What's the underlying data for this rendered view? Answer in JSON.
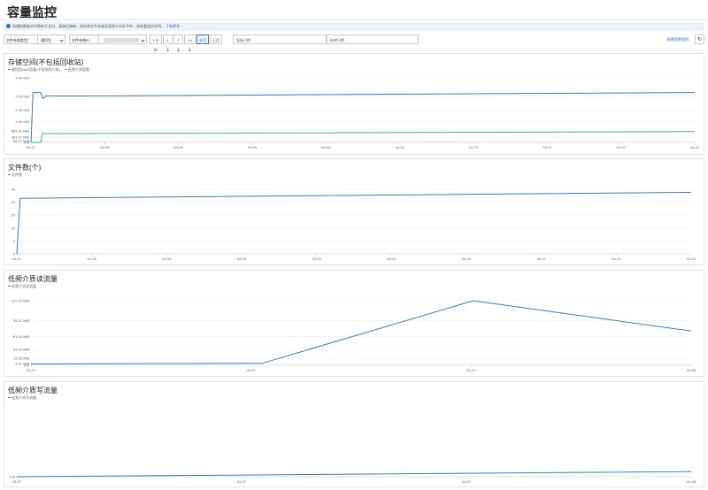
{
  "page": {
    "title": "容量监控"
  },
  "notice": {
    "text": "如遇新数据实时更新不及时，请稍后刷新，如存储文件系统总容量与实际不符，请查看监控说明。",
    "link": "了解更多"
  },
  "toolbar": {
    "fs_type_label": "文件系统类型：",
    "fs_type_value": "通用型",
    "fs_id_label": "文件系统ID：",
    "ranges": [
      "1 小时",
      "1 天",
      "7 天",
      "14 天",
      "本月",
      "上月"
    ],
    "active_range": "本月",
    "start_date": "起始日期",
    "end_date": "结束日期",
    "alarm_link": "配置报警规则",
    "refresh_icon": "refresh-icon"
  },
  "colors": {
    "blue": "#3b7fb6",
    "green": "#3fb68b"
  },
  "charts": [
    {
      "title": "存储空间(不包括回收站)",
      "legend": [
        "通用型NAS容量(不含低频介质)",
        "低频介质容量"
      ],
      "chart_data": {
        "type": "line",
        "yticks": [
          "4.66 GiB",
          "3.33 GiB",
          "2.33 GiB",
          "1.49 GiB",
          "858.31 MiB",
          "381.47 MiB",
          "95.37 MiB",
          "0 B"
        ],
        "xticks": [
          "04-07",
          "04-08",
          "04-08",
          "04-09",
          "04-09",
          "04-10",
          "04-10",
          "04-11",
          "04-12",
          "04-12"
        ],
        "series": [
          {
            "name": "通用型NAS容量(不含低频介质)",
            "color": "#3b7fb6",
            "points": [
              [
                0,
                0
              ],
              [
                0.3,
                3.6
              ],
              [
                1.5,
                3.6
              ],
              [
                1.7,
                3.2
              ],
              [
                2.0,
                3.2
              ],
              [
                2.2,
                3.35
              ],
              [
                8,
                3.35
              ],
              [
                100,
                3.6
              ]
            ]
          },
          {
            "name": "低频介质容量",
            "color": "#3fb68b",
            "points": [
              [
                0,
                0
              ],
              [
                1.5,
                0
              ],
              [
                1.7,
                0.65
              ],
              [
                2.0,
                0.65
              ],
              [
                2.2,
                0.63
              ],
              [
                100,
                0.78
              ]
            ]
          }
        ]
      }
    },
    {
      "title": "文件数(个)",
      "legend": [
        "文件数"
      ],
      "chart_data": {
        "type": "line",
        "yticks": [
          "25",
          "20",
          "15",
          "10",
          "5",
          "0"
        ],
        "xticks": [
          "04-07",
          "04-08",
          "04-08",
          "04-09",
          "04-09",
          "04-10",
          "04-10",
          "04-11",
          "04-12",
          "04-12"
        ],
        "series": [
          {
            "name": "文件数",
            "color": "#3b7fb6",
            "points": [
              [
                0,
                0
              ],
              [
                0.5,
                21.5
              ],
              [
                100,
                23.8
              ]
            ]
          }
        ]
      }
    },
    {
      "title": "低频介质读流量",
      "legend": [
        "低频介质读流量"
      ],
      "chart_data": {
        "type": "line",
        "yticks": [
          "137.33 MiB",
          "95.37 MiB",
          "61.04 MiB",
          "34.33 MiB",
          "15.26 MiB",
          "3.81 MiB",
          "0 B"
        ],
        "xticks": [
          "04-07",
          "04-07",
          "04-07",
          "04-08"
        ],
        "series": [
          {
            "name": "低频介质读流量",
            "color": "#3b7fb6",
            "points": [
              [
                0,
                0.02
              ],
              [
                35,
                0.03
              ],
              [
                67,
                1.0
              ],
              [
                100,
                0.53
              ]
            ]
          }
        ]
      }
    },
    {
      "title": "低频介质写流量",
      "legend": [
        "低频介质写流量"
      ],
      "chart_data": {
        "type": "line",
        "yticks": [
          "0 B"
        ],
        "xticks": [
          "04-07",
          "04-07",
          "04-07",
          "04-08"
        ],
        "series": [
          {
            "name": "低频介质写流量",
            "color": "#3b7fb6",
            "points": [
              [
                0,
                0
              ],
              [
                100,
                0.08
              ]
            ]
          }
        ]
      }
    }
  ]
}
